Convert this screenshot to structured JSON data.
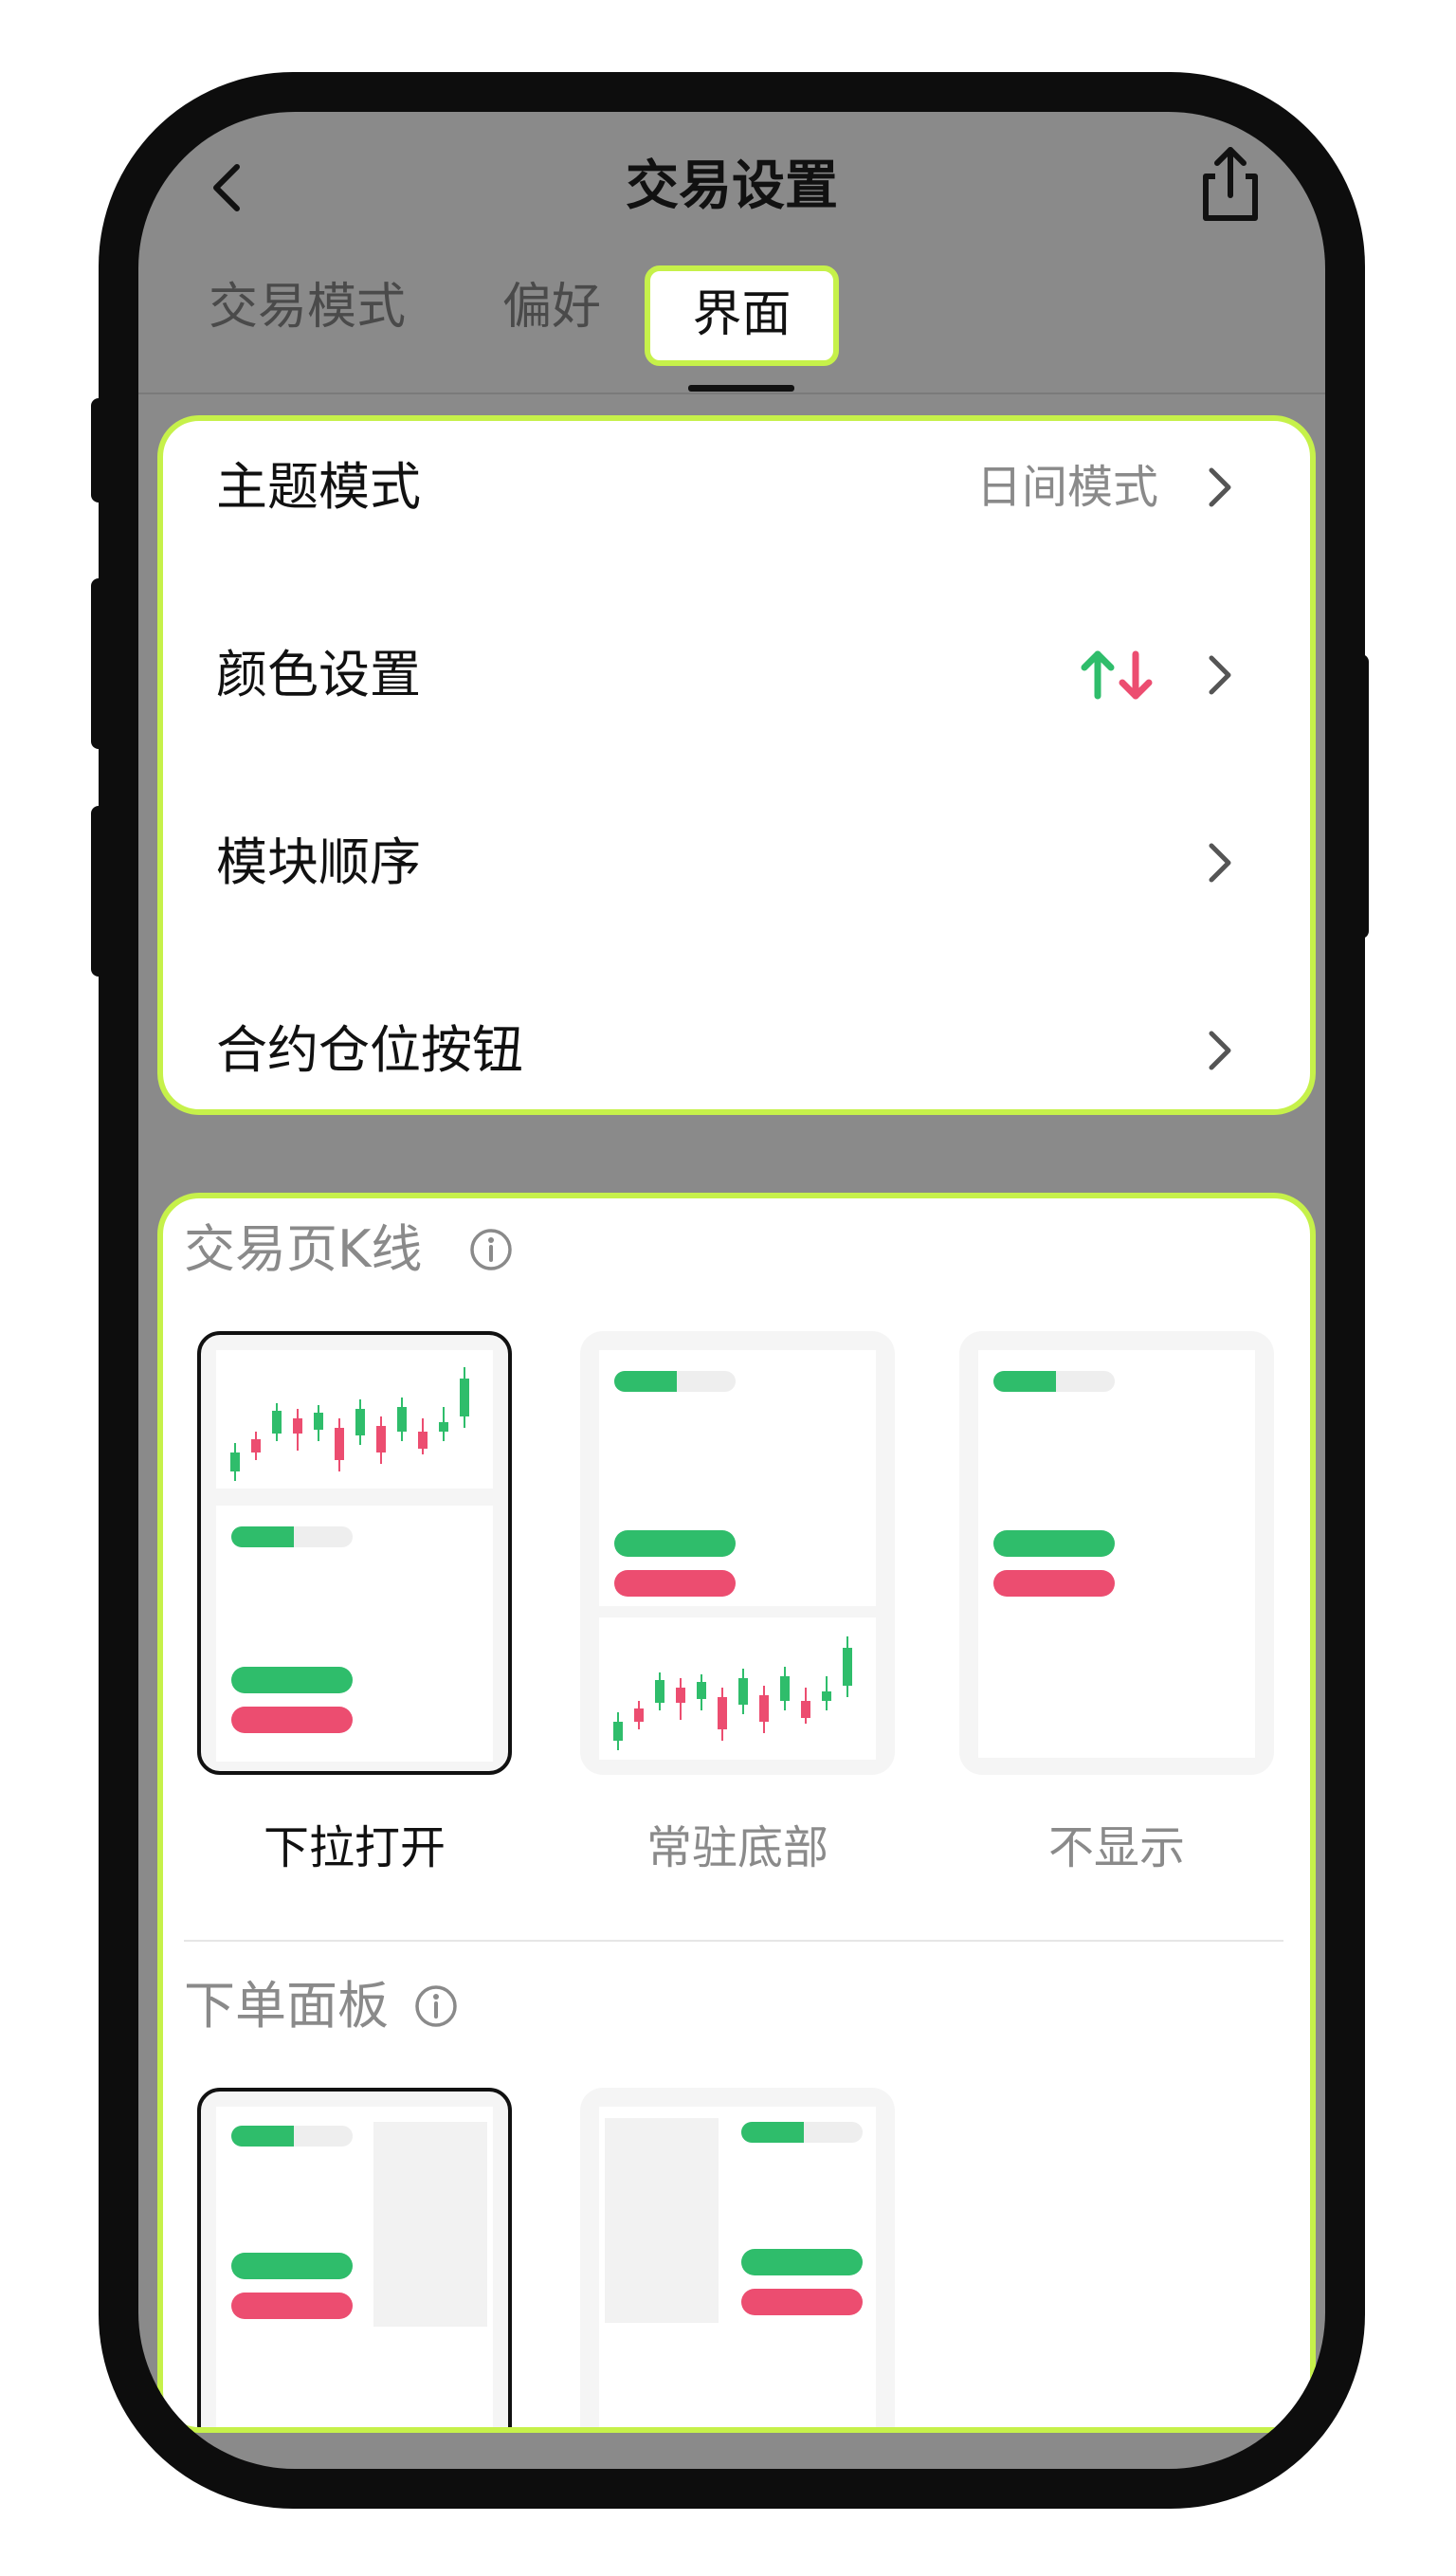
{
  "header": {
    "title": "交易设置",
    "back_icon": "back-icon",
    "share_icon": "share-icon"
  },
  "tabs": [
    {
      "label": "交易模式",
      "active": false
    },
    {
      "label": "偏好",
      "active": false
    },
    {
      "label": "界面",
      "active": true
    }
  ],
  "settings": [
    {
      "label": "主题模式",
      "value": "日间模式"
    },
    {
      "label": "颜色设置",
      "value_icon": "up-down-arrows-icon"
    },
    {
      "label": "模块顺序"
    },
    {
      "label": "合约仓位按钮"
    }
  ],
  "kline_section": {
    "title": "交易页K线",
    "info_icon": "info-icon",
    "options": [
      {
        "label": "下拉打开",
        "selected": true
      },
      {
        "label": "常驻底部",
        "selected": false
      },
      {
        "label": "不显示",
        "selected": false
      }
    ]
  },
  "order_panel_section": {
    "title": "下单面板",
    "info_icon": "info-icon",
    "options": [
      {
        "selected": true
      },
      {
        "selected": false
      }
    ]
  },
  "colors": {
    "accent": "#c6f14a",
    "up": "#2fbd6b",
    "down": "#ec4d70",
    "text_muted": "#8a8a8a"
  }
}
